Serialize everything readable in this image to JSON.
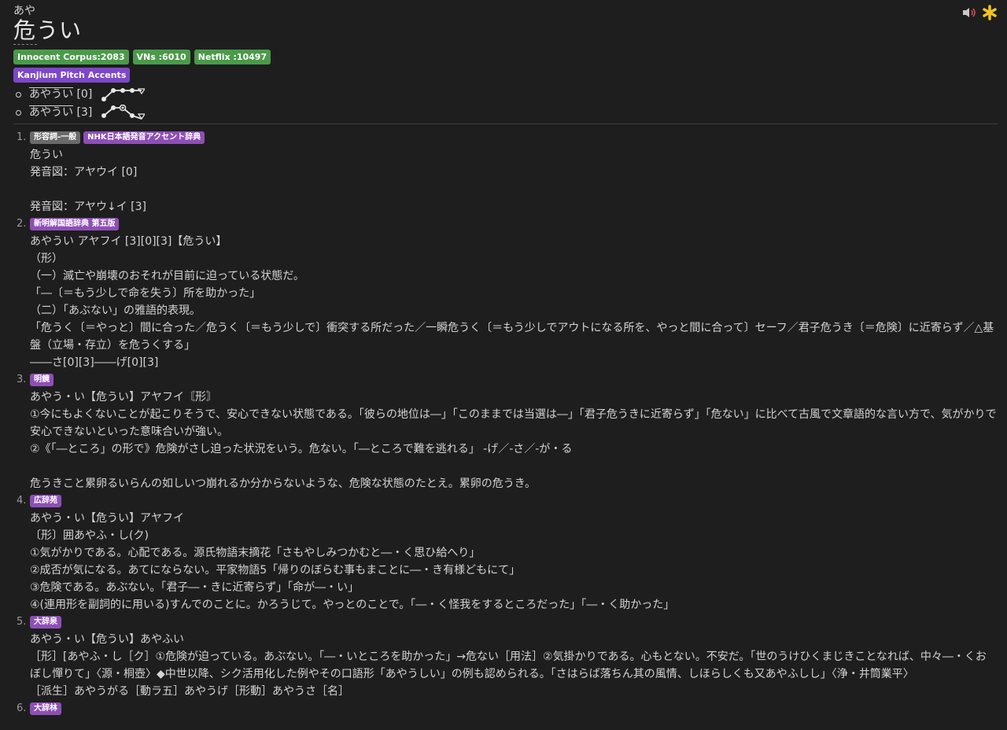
{
  "header": {
    "reading": "あや",
    "headword": "危うい",
    "freq_tags": [
      "Innocent Corpus:2083",
      "VNs :6010",
      "Netflix :10497"
    ],
    "pitch_tag": "Kanjium Pitch Accents",
    "pitches": [
      {
        "kana": "あやうい",
        "accent": "[0]"
      },
      {
        "kana": "あやうい",
        "accent": "[3]"
      }
    ]
  },
  "icons": {
    "speaker": "speaker-icon",
    "star": "asterisk-icon",
    "accent_color": "#f0c420"
  },
  "definitions": [
    {
      "num": "1.",
      "tags": [
        {
          "text": "形容詞-一般",
          "style": "gray"
        },
        {
          "text": "NHK日本語発音アクセント辞典",
          "style": "violet"
        }
      ],
      "lines": [
        "危うい",
        "発音図：アヤウイ [0]",
        "",
        "発音図：アヤウ↓イ [3]"
      ]
    },
    {
      "num": "2.",
      "tags": [
        {
          "text": "新明解国語辞典 第五版",
          "style": "violet"
        }
      ],
      "lines": [
        "あやうい アヤフイ [3][0][3]【危うい】",
        "（形）",
        "（一）滅亡や崩壊のおそれが目前に迫っている状態だ。",
        "「―〔＝もう少しで命を失う〕所を助かった」",
        "（二）「あぶない」の雅語的表現。",
        "「危うく〔＝やっと〕間に合った／危うく〔＝もう少しで〕衝突する所だった／一瞬危うく〔＝もう少しでアウトになる所を、やっと間に合って〕セーフ／君子危うき〔＝危険〕に近寄らず／△基盤（立場・存立）を危うくする」",
        "――さ[0][3]――げ[0][3]"
      ]
    },
    {
      "num": "3.",
      "tags": [
        {
          "text": "明鏡",
          "style": "violet"
        }
      ],
      "lines": [
        "あやう・い【危うい】アヤフイ〘形〙",
        "①今にもよくないことが起こりそうで、安心できない状態である。「彼らの地位は―」「このままでは当選は―」「君子危うきに近寄らず」「危ない」に比べて古風で文章語的な言い方で、気がかりで安心できないといった意味合いが強い。",
        "②《「―ところ」の形で》危険がさし迫った状況をいう。危ない。「―ところで難を逃れる」 -げ／-さ／-が・る",
        "",
        "危うきこと累卵るいらんの如しいつ崩れるか分からないような、危険な状態のたとえ。累卵の危うき。"
      ]
    },
    {
      "num": "4.",
      "tags": [
        {
          "text": "広辞苑",
          "style": "violet"
        }
      ],
      "lines": [
        "あやう・い【危うい】アヤフイ",
        "〔形〕囲あやふ・し(ク)",
        "①気がかりである。心配である。源氏物語末摘花「さもやしみつかむと―・く思ひ給へり」",
        "②成否が気になる。あてにならない。平家物語5「帰りのぼらむ事もまことに―・き有様どもにて」",
        "③危険である。あぶない。「君子―・きに近寄らず」「命が―・い」",
        "④(連用形を副詞的に用いる)すんでのことに。かろうじて。やっとのことで。「―・く怪我をするところだった」「―・く助かった」"
      ]
    },
    {
      "num": "5.",
      "tags": [
        {
          "text": "大辞泉",
          "style": "violet"
        }
      ],
      "lines": [
        "あやう・い【危うい】あやふい",
        "［形］[あやふ・し［ク］①危険が迫っている。あぶない。「―・いところを助かった」→危ない［用法］②気掛かりである。心もとない。不安だ。「世のうけひくまじきことなれば、中々―・くおぼし憚りて」〈源・桐壺〉◆中世以降、シク活用化した例やその口語形「あやうしい」の例も認められる。「さはらば落ちん其の風情、しほらしくも又あやふしし」〈浄・井筒業平〉",
        "［派生］あやうがる［動ラ五］あやうげ［形動］あやうさ［名］"
      ]
    },
    {
      "num": "6.",
      "tags": [
        {
          "text": "大辞林",
          "style": "violet"
        }
      ],
      "lines": []
    }
  ]
}
